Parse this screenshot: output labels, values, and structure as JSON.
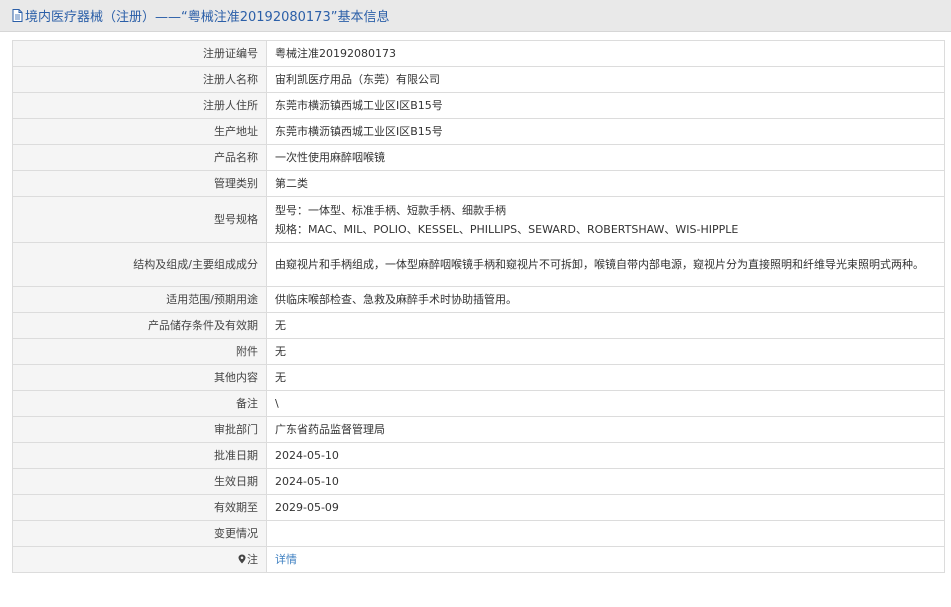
{
  "header": {
    "title": "境内医疗器械（注册）——“粤械注准20192080173”基本信息",
    "icon": "document-icon"
  },
  "rows": [
    {
      "key": "reg_no",
      "label": "注册证编号",
      "value": "粤械注准20192080173"
    },
    {
      "key": "registrant",
      "label": "注册人名称",
      "value": "宙利凯医疗用品（东莞）有限公司"
    },
    {
      "key": "registrant_address",
      "label": "注册人住所",
      "value": "东莞市横沥镇西城工业区Ⅰ区B15号"
    },
    {
      "key": "production_address",
      "label": "生产地址",
      "value": "东莞市横沥镇西城工业区Ⅰ区B15号"
    },
    {
      "key": "product_name",
      "label": "产品名称",
      "value": "一次性使用麻醉咽喉镜"
    },
    {
      "key": "category",
      "label": "管理类别",
      "value": "第二类"
    },
    {
      "key": "model_spec",
      "label": "型号规格",
      "lines": [
        "型号：一体型、标准手柄、短款手柄、细款手柄",
        "规格：MAC、MIL、POLIO、KESSEL、PHILLIPS、SEWARD、ROBERTSHAW、WIS-HIPPLE"
      ]
    },
    {
      "key": "structure",
      "label": "结构及组成/主要组成成分",
      "value": "由窥视片和手柄组成，一体型麻醉咽喉镜手柄和窥视片不可拆卸，喉镜自带内部电源，窥视片分为直接照明和纤维导光束照明式两种。"
    },
    {
      "key": "intended_use",
      "label": "适用范围/预期用途",
      "value": "供临床喉部检查、急救及麻醉手术时协助插管用。"
    },
    {
      "key": "storage",
      "label": "产品储存条件及有效期",
      "value": "无"
    },
    {
      "key": "attachment",
      "label": "附件",
      "value": "无"
    },
    {
      "key": "other",
      "label": "其他内容",
      "value": "无"
    },
    {
      "key": "remark",
      "label": "备注",
      "value": "\\"
    },
    {
      "key": "approval_dept",
      "label": "审批部门",
      "value": "广东省药品监督管理局"
    },
    {
      "key": "approval_date",
      "label": "批准日期",
      "value": "2024-05-10"
    },
    {
      "key": "effective_date",
      "label": "生效日期",
      "value": "2024-05-10"
    },
    {
      "key": "expiry_date",
      "label": "有效期至",
      "value": "2029-05-09"
    },
    {
      "key": "changes",
      "label": "变更情况",
      "value": ""
    },
    {
      "key": "note",
      "label": "注",
      "value": "详情",
      "icon": "location-pin-icon"
    }
  ]
}
